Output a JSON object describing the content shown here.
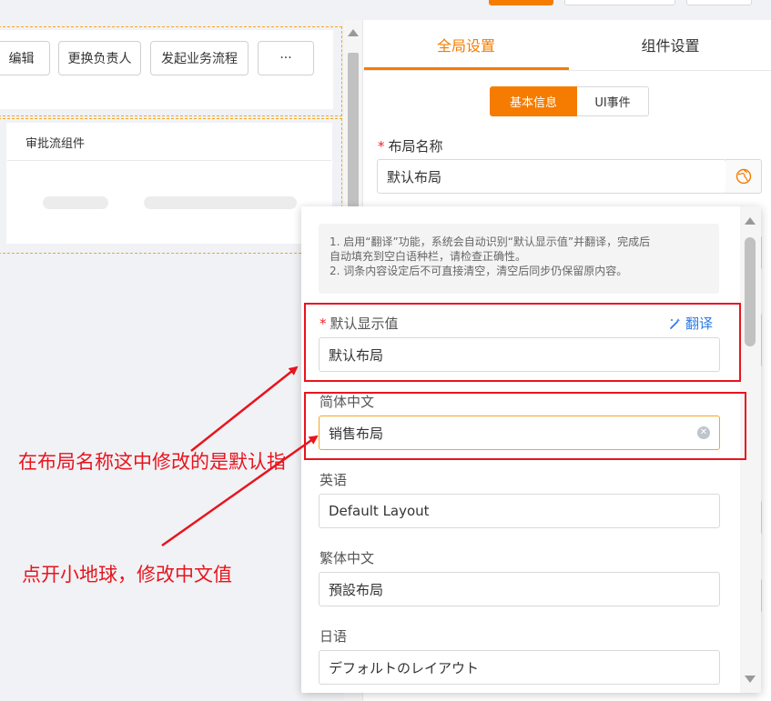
{
  "toolbar": {
    "buttons": [
      "编辑",
      "更换负责人",
      "发起业务流程",
      "···"
    ]
  },
  "approval": {
    "title": "审批流组件"
  },
  "tabs": [
    {
      "label": "全局设置",
      "active": true
    },
    {
      "label": "组件设置",
      "active": false
    }
  ],
  "segments": [
    {
      "label": "基本信息",
      "active": true
    },
    {
      "label": "UI事件",
      "active": false
    }
  ],
  "layout_name": {
    "label": "布局名称",
    "required": "*",
    "value": "默认布局",
    "globe_icon": "globe-icon"
  },
  "popover": {
    "notice_lines": [
      "1. 启用“翻译”功能，系统会自动识别“默认显示值”并翻译，完成后",
      "自动填充到空白语种栏，请检查正确性。",
      "2. 词条内容设定后不可直接清空，清空后同步仍保留原内容。"
    ],
    "default": {
      "label": "默认显示值",
      "required": "*",
      "value": "默认布局",
      "translate_label": "翻译",
      "translate_icon": "magic-wand-icon"
    },
    "languages": [
      {
        "label": "简体中文",
        "value": "销售布局",
        "focused": true
      },
      {
        "label": "英语",
        "value": "Default Layout",
        "focused": false
      },
      {
        "label": "繁体中文",
        "value": "預設布局",
        "focused": false
      },
      {
        "label": "日语",
        "value": "デフォルトのレイアウト",
        "focused": false
      }
    ]
  },
  "annotations": {
    "text1": "在布局名称这中修改的是默认指",
    "text2": "点开小地球，修改中文值",
    "color": "#e8141e"
  },
  "colors": {
    "accent": "#f57c00",
    "link": "#2d7be5",
    "required": "#f5222d",
    "annotation_red": "#e8141e"
  }
}
